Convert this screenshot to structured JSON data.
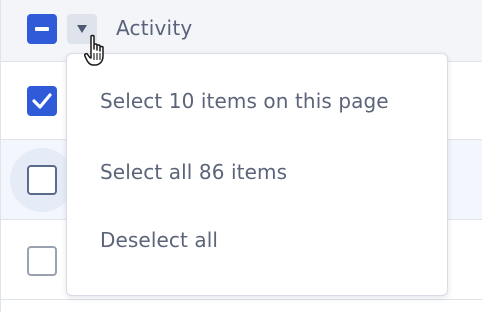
{
  "table": {
    "column_header": "Activity"
  },
  "rows": [
    {
      "checked": true
    },
    {
      "checked": false
    },
    {
      "checked": false
    }
  ],
  "menu": {
    "items": [
      {
        "label": "Select 10 items on this page"
      },
      {
        "label": "Select all 86 items"
      },
      {
        "label": "Deselect all"
      }
    ]
  },
  "colors": {
    "accent": "#2f5bd8",
    "text": "#5b6479",
    "header_bg": "#f4f5f8",
    "hover_row_bg": "#f3f6fc"
  },
  "icons": {
    "header_checkbox": "minus-icon",
    "toggle": "caret-down-icon",
    "checked": "check-icon",
    "cursor": "hand-pointer-icon"
  }
}
